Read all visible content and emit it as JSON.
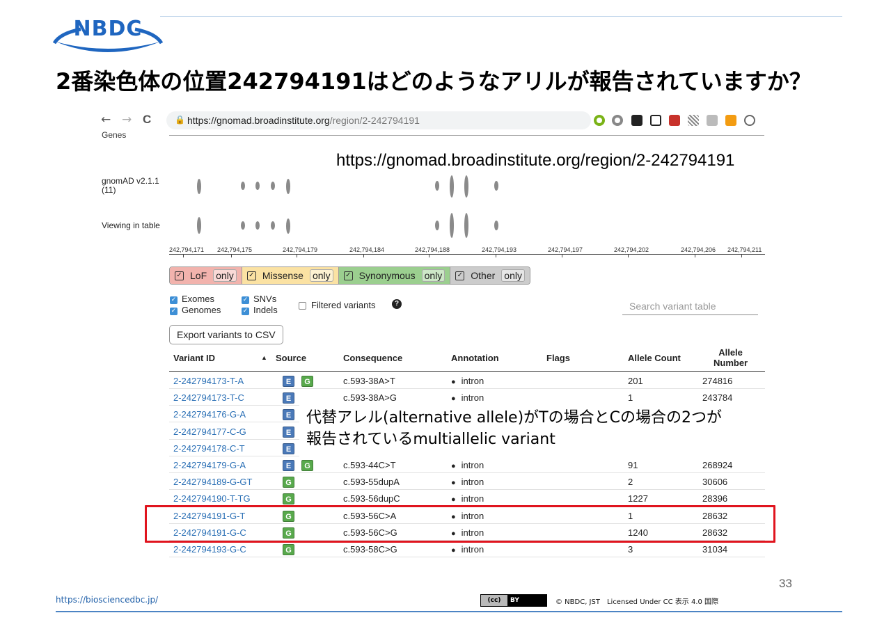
{
  "slide": {
    "logo_text": "NBDC",
    "title": "2番染色体の位置242794191はどのようなアリルが報告されていますか？",
    "page_number": "33",
    "footer_url": "https://biosciencedbc.jp/",
    "cc_left": "(cc)",
    "cc_right": "BY",
    "copyright": "© NBDC, JST　Licensed Under CC 表示 4.0 国際",
    "url_callout": "https://gnomad.broadinstitute.org/region/2-242794191",
    "callout_line1": "代替アレル(alternative allele)がTの場合とCの場合の2つが",
    "callout_line2": "報告されているmultiallelic variant"
  },
  "browser": {
    "back": "←",
    "forward": "→",
    "reload": "C",
    "url_host": "https://gnomad.broadinstitute.org",
    "url_path": "/region/2-242794191",
    "star": "☆"
  },
  "tracks": {
    "genes_label": "Genes",
    "gnomad_label_1": "gnomAD v2.1.1",
    "gnomad_label_2": "(11)",
    "viewing_label": "Viewing in table"
  },
  "axis_ticks": [
    "242,794,171",
    "242,794,175",
    "242,794,179",
    "242,794,184",
    "242,794,188",
    "242,794,193",
    "242,794,197",
    "242,794,202",
    "242,794,206",
    "242,794,211"
  ],
  "filters": {
    "lof": "LoF",
    "missense": "Missense",
    "synonymous": "Synonymous",
    "other": "Other",
    "only": "only",
    "exomes": "Exomes",
    "genomes": "Genomes",
    "snvs": "SNVs",
    "indels": "Indels",
    "filtered": "Filtered variants",
    "search_placeholder": "Search variant table",
    "export": "Export variants to CSV"
  },
  "table": {
    "headers": {
      "variant_id": "Variant ID",
      "sort_icon": "▲",
      "source": "Source",
      "consequence": "Consequence",
      "annotation": "Annotation",
      "flags": "Flags",
      "allele_count": "Allele Count",
      "allele_number_1": "Allele",
      "allele_number_2": "Number"
    },
    "rows": [
      {
        "id": "2-242794173-T-A",
        "e": "E",
        "g": "G",
        "consequence": "c.593-38A>T",
        "annotation": "intron",
        "ac": "201",
        "an": "274816"
      },
      {
        "id": "2-242794173-T-C",
        "e": "E",
        "g": "",
        "consequence": "c.593-38A>G",
        "annotation": "intron",
        "ac": "1",
        "an": "243784"
      },
      {
        "id": "2-242794176-G-A",
        "e": "E",
        "g": "",
        "consequence": "",
        "annotation": "",
        "ac": "",
        "an": ""
      },
      {
        "id": "2-242794177-C-G",
        "e": "E",
        "g": "",
        "consequence": "",
        "annotation": "",
        "ac": "",
        "an": ""
      },
      {
        "id": "2-242794178-C-T",
        "e": "E",
        "g": "",
        "consequence": "",
        "annotation": "",
        "ac": "",
        "an": ""
      },
      {
        "id": "2-242794179-G-A",
        "e": "E",
        "g": "G",
        "consequence": "c.593-44C>T",
        "annotation": "intron",
        "ac": "91",
        "an": "268924"
      },
      {
        "id": "2-242794189-G-GT",
        "e": "",
        "g": "G",
        "consequence": "c.593-55dupA",
        "annotation": "intron",
        "ac": "2",
        "an": "30606"
      },
      {
        "id": "2-242794190-T-TG",
        "e": "",
        "g": "G",
        "consequence": "c.593-56dupC",
        "annotation": "intron",
        "ac": "1227",
        "an": "28396"
      },
      {
        "id": "2-242794191-G-T",
        "e": "",
        "g": "G",
        "consequence": "c.593-56C>A",
        "annotation": "intron",
        "ac": "1",
        "an": "28632"
      },
      {
        "id": "2-242794191-G-C",
        "e": "",
        "g": "G",
        "consequence": "c.593-56C>G",
        "annotation": "intron",
        "ac": "1240",
        "an": "28632"
      },
      {
        "id": "2-242794193-G-C",
        "e": "",
        "g": "G",
        "consequence": "c.593-58C>G",
        "annotation": "intron",
        "ac": "3",
        "an": "31034"
      }
    ]
  },
  "colors": {
    "lof": "#f2b3ad",
    "missense": "#fbe2a3",
    "synonymous": "#9bcf8f",
    "other": "#cccccc",
    "exome_badge": "#4a79b8",
    "genome_badge": "#58a94c",
    "highlight": "#e0141e",
    "link": "#2a6fb5"
  }
}
